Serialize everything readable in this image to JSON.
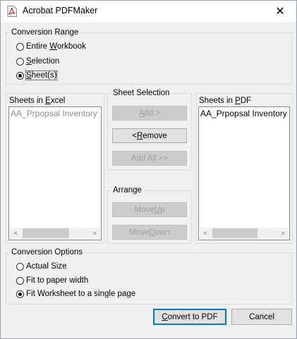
{
  "window": {
    "title": "Acrobat PDFMaker",
    "close_glyph": "✕",
    "icon": "pdf-icon"
  },
  "conversion_range": {
    "label": "Conversion Range",
    "options": [
      {
        "pre": "Entire ",
        "key": "W",
        "post": "orkbook",
        "checked": false
      },
      {
        "pre": "",
        "key": "S",
        "post": "election",
        "checked": false
      },
      {
        "pre": "",
        "key": "S",
        "post": "heet(s)",
        "checked": true
      }
    ]
  },
  "sheets_in_excel": {
    "pre": "Sheets in ",
    "key": "E",
    "post": "xcel",
    "items": [
      "AA_Prpopsal Inventory"
    ]
  },
  "sheet_selection": {
    "label": "Sheet Selection",
    "add": {
      "pre": "",
      "key": "A",
      "post": "dd >",
      "enabled": false
    },
    "remove": {
      "pre": "< ",
      "key": "R",
      "post": "emove",
      "enabled": true
    },
    "add_all": {
      "pre": "Add A",
      "key": "l",
      "post": "l >>",
      "enabled": false
    }
  },
  "arrange": {
    "label": "Arrange",
    "move_up": {
      "pre": "Move ",
      "key": "U",
      "post": "p",
      "enabled": false
    },
    "move_down": {
      "pre": "Move ",
      "key": "D",
      "post": "own",
      "enabled": false
    }
  },
  "sheets_in_pdf": {
    "pre": "Sheets in ",
    "key": "P",
    "post": "DF",
    "items": [
      "AA_Prpopsal Inventory"
    ]
  },
  "conversion_options": {
    "label": "Conversion Options",
    "options": [
      {
        "text": "Actual Size",
        "checked": false
      },
      {
        "text": "Fit to paper width",
        "checked": false
      },
      {
        "text": "Fit Worksheet to a single page",
        "checked": true
      }
    ]
  },
  "footer": {
    "convert": {
      "pre": "",
      "key": "C",
      "post": "onvert to PDF"
    },
    "cancel": "Cancel"
  },
  "scroll_arrows": {
    "left": "<",
    "right": ">"
  },
  "colors": {
    "accent": "#0078d7",
    "disabled_text": "#a0a0a0",
    "pdf_red": "#d2232a"
  }
}
